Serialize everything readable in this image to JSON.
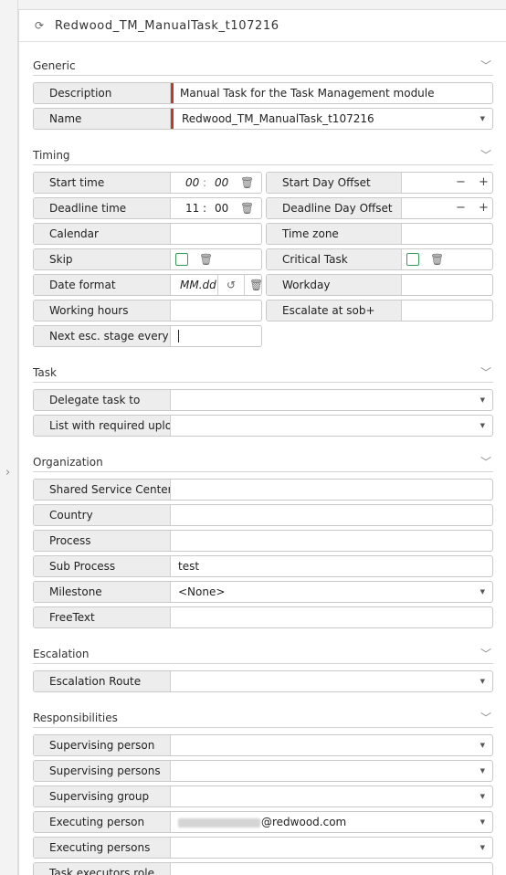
{
  "title": "Redwood_TM_ManualTask_t107216",
  "sections": {
    "generic": "Generic",
    "timing": "Timing",
    "task": "Task",
    "organization": "Organization",
    "escalation": "Escalation",
    "responsibilities": "Responsibilities"
  },
  "generic": {
    "description_label": "Description",
    "description_value": "Manual Task for the Task Management module",
    "name_label": "Name",
    "name_value": "Redwood_TM_ManualTask_t107216"
  },
  "timing": {
    "start_time_label": "Start time",
    "start_time_hour_placeholder": "00",
    "start_time_min_placeholder": "00",
    "start_day_offset_label": "Start Day Offset",
    "deadline_time_label": "Deadline time",
    "deadline_hour": "11",
    "deadline_min": "00",
    "deadline_day_offset_label": "Deadline Day Offset",
    "calendar_label": "Calendar",
    "time_zone_label": "Time zone",
    "skip_label": "Skip",
    "critical_task_label": "Critical Task",
    "date_format_label": "Date format",
    "date_format_placeholder": "MM.dd",
    "workday_label": "Workday",
    "working_hours_label": "Working hours",
    "escalate_label": "Escalate at sob+",
    "next_esc_label": "Next esc. stage every",
    "time_separator": ":",
    "minus": "−",
    "plus": "+"
  },
  "task": {
    "delegate_label": "Delegate task to",
    "list_upload_label": "List with required uploa"
  },
  "organization": {
    "ssc_label": "Shared Service Center",
    "country_label": "Country",
    "process_label": "Process",
    "sub_process_label": "Sub Process",
    "sub_process_value": "test",
    "milestone_label": "Milestone",
    "milestone_value": "<None>",
    "freetext_label": "FreeText"
  },
  "escalation": {
    "route_label": "Escalation Route"
  },
  "responsibilities": {
    "supervising_person_label": "Supervising person",
    "supervising_persons_label": "Supervising persons",
    "supervising_group_label": "Supervising group",
    "executing_person_label": "Executing person",
    "executing_person_value": "@redwood.com",
    "executing_persons_label": "Executing persons",
    "task_executors_role_label": "Task executors role"
  },
  "colors": {
    "required_marker": "#c0392b",
    "checkbox_border": "#3a9a5a",
    "label_bg": "#ededed"
  },
  "icons": {
    "title": "task-sync-icon",
    "pin": "pin-icon",
    "trash": "trash-icon",
    "dropdown": "chevron-down-icon",
    "reset": "reset-icon",
    "collapse": "chevron-right-icon"
  }
}
